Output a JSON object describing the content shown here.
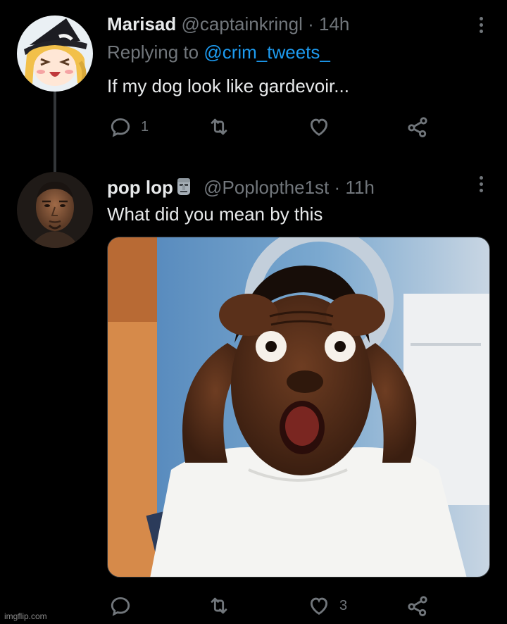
{
  "tweets": [
    {
      "name": "Marisad",
      "handle": "@captainkringl",
      "separator": "·",
      "time": "14h",
      "replying_prefix": "Replying to",
      "replying_to": "@crim_tweets_",
      "text": "If my dog look like gardevoir...",
      "reply_count": "1",
      "retweet_count": "",
      "like_count": ""
    },
    {
      "name": "pop lop",
      "name_emoji": "moai-emoji",
      "handle": "@Poplopthe1st",
      "separator": "·",
      "time": "11h",
      "text": "What did you mean by this",
      "media_description": "shocked man with hands on head",
      "reply_count": "",
      "retweet_count": "",
      "like_count": "3"
    }
  ],
  "watermark": "imgflip.com",
  "colors": {
    "background": "#000000",
    "primary_text": "#e7e9ea",
    "secondary_text": "#71767b",
    "link": "#1d9bf0",
    "thread_line": "#333639"
  }
}
